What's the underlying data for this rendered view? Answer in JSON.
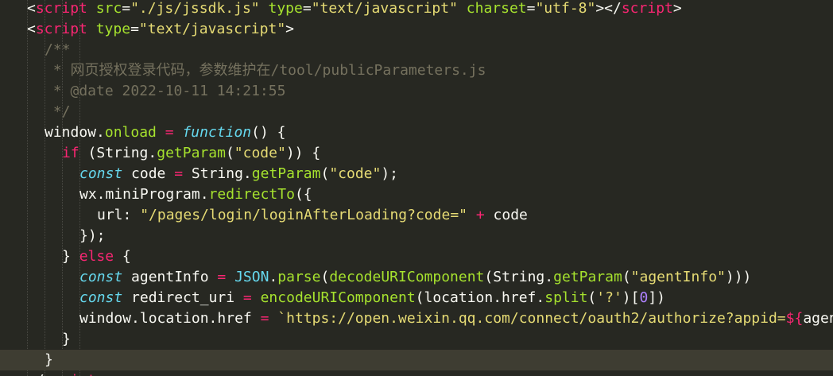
{
  "lines": [
    {
      "tokens": [
        {
          "t": "<",
          "c": "t-punct"
        },
        {
          "t": "script",
          "c": "t-tag"
        },
        {
          "t": " ",
          "c": "t-plain"
        },
        {
          "t": "src",
          "c": "t-attr"
        },
        {
          "t": "=",
          "c": "t-punct"
        },
        {
          "t": "\"./js/jssdk.js\"",
          "c": "t-str"
        },
        {
          "t": " ",
          "c": "t-plain"
        },
        {
          "t": "type",
          "c": "t-attr"
        },
        {
          "t": "=",
          "c": "t-punct"
        },
        {
          "t": "\"text/javascript\"",
          "c": "t-str"
        },
        {
          "t": " ",
          "c": "t-plain"
        },
        {
          "t": "charset",
          "c": "t-attr"
        },
        {
          "t": "=",
          "c": "t-punct"
        },
        {
          "t": "\"utf-8\"",
          "c": "t-str"
        },
        {
          "t": "></",
          "c": "t-punct"
        },
        {
          "t": "script",
          "c": "t-tag"
        },
        {
          "t": ">",
          "c": "t-punct"
        }
      ]
    },
    {
      "tokens": [
        {
          "t": "<",
          "c": "t-punct"
        },
        {
          "t": "script",
          "c": "t-tag"
        },
        {
          "t": " ",
          "c": "t-plain"
        },
        {
          "t": "type",
          "c": "t-attr"
        },
        {
          "t": "=",
          "c": "t-punct"
        },
        {
          "t": "\"text/javascript\"",
          "c": "t-str"
        },
        {
          "t": ">",
          "c": "t-punct"
        }
      ]
    },
    {
      "tokens": [
        {
          "t": "/**",
          "c": "t-comment"
        }
      ]
    },
    {
      "tokens": [
        {
          "t": " * 网页授权登录代码，参数维护在/tool/publicParameters.js",
          "c": "t-comment"
        }
      ]
    },
    {
      "tokens": [
        {
          "t": " * @date 2022-10-11 14:21:55",
          "c": "t-comment"
        }
      ]
    },
    {
      "tokens": [
        {
          "t": " */",
          "c": "t-comment"
        }
      ]
    },
    {
      "tokens": [
        {
          "t": "window",
          "c": "t-plain"
        },
        {
          "t": ".",
          "c": "t-plain"
        },
        {
          "t": "onload",
          "c": "t-func"
        },
        {
          "t": " ",
          "c": "t-plain"
        },
        {
          "t": "=",
          "c": "t-op"
        },
        {
          "t": " ",
          "c": "t-plain"
        },
        {
          "t": "function",
          "c": "t-kw"
        },
        {
          "t": "() ",
          "c": "t-plain"
        },
        {
          "t": "{",
          "c": "t-plain"
        }
      ]
    },
    {
      "tokens": [
        {
          "t": "if",
          "c": "t-ctrl"
        },
        {
          "t": " (String.",
          "c": "t-plain"
        },
        {
          "t": "getParam",
          "c": "t-func"
        },
        {
          "t": "(",
          "c": "t-plain"
        },
        {
          "t": "\"code\"",
          "c": "t-str"
        },
        {
          "t": ")) {",
          "c": "t-plain"
        }
      ]
    },
    {
      "tokens": [
        {
          "t": "const",
          "c": "t-kw"
        },
        {
          "t": " code ",
          "c": "t-plain"
        },
        {
          "t": "=",
          "c": "t-op"
        },
        {
          "t": " String.",
          "c": "t-plain"
        },
        {
          "t": "getParam",
          "c": "t-func"
        },
        {
          "t": "(",
          "c": "t-plain"
        },
        {
          "t": "\"code\"",
          "c": "t-str"
        },
        {
          "t": ");",
          "c": "t-plain"
        }
      ]
    },
    {
      "tokens": [
        {
          "t": "wx.miniProgram.",
          "c": "t-plain"
        },
        {
          "t": "redirectTo",
          "c": "t-func"
        },
        {
          "t": "({",
          "c": "t-plain"
        }
      ]
    },
    {
      "tokens": [
        {
          "t": "url: ",
          "c": "t-plain"
        },
        {
          "t": "\"/pages/login/loginAfterLoading?code=\"",
          "c": "t-str"
        },
        {
          "t": " ",
          "c": "t-plain"
        },
        {
          "t": "+",
          "c": "t-op"
        },
        {
          "t": " code",
          "c": "t-plain"
        }
      ]
    },
    {
      "tokens": [
        {
          "t": "});",
          "c": "t-plain"
        }
      ]
    },
    {
      "tokens": [
        {
          "t": "} ",
          "c": "t-plain"
        },
        {
          "t": "else",
          "c": "t-ctrl"
        },
        {
          "t": " {",
          "c": "t-plain"
        }
      ]
    },
    {
      "tokens": [
        {
          "t": "const",
          "c": "t-kw"
        },
        {
          "t": " agentInfo ",
          "c": "t-plain"
        },
        {
          "t": "=",
          "c": "t-op"
        },
        {
          "t": " ",
          "c": "t-plain"
        },
        {
          "t": "JSON",
          "c": "t-builtin"
        },
        {
          "t": ".",
          "c": "t-plain"
        },
        {
          "t": "parse",
          "c": "t-func"
        },
        {
          "t": "(",
          "c": "t-plain"
        },
        {
          "t": "decodeURIComponent",
          "c": "t-func"
        },
        {
          "t": "(String.",
          "c": "t-plain"
        },
        {
          "t": "getParam",
          "c": "t-func"
        },
        {
          "t": "(",
          "c": "t-plain"
        },
        {
          "t": "\"agentInfo\"",
          "c": "t-str"
        },
        {
          "t": ")))",
          "c": "t-plain"
        }
      ]
    },
    {
      "tokens": [
        {
          "t": "const",
          "c": "t-kw"
        },
        {
          "t": " redirect_uri ",
          "c": "t-plain"
        },
        {
          "t": "=",
          "c": "t-op"
        },
        {
          "t": " ",
          "c": "t-plain"
        },
        {
          "t": "encodeURIComponent",
          "c": "t-func"
        },
        {
          "t": "(location.href.",
          "c": "t-plain"
        },
        {
          "t": "split",
          "c": "t-func"
        },
        {
          "t": "(",
          "c": "t-plain"
        },
        {
          "t": "'?'",
          "c": "t-str"
        },
        {
          "t": ")[",
          "c": "t-plain"
        },
        {
          "t": "0",
          "c": "t-num"
        },
        {
          "t": "])",
          "c": "t-plain"
        }
      ]
    },
    {
      "tokens": [
        {
          "t": "window.location.href ",
          "c": "t-plain"
        },
        {
          "t": "=",
          "c": "t-op"
        },
        {
          "t": " ",
          "c": "t-plain"
        },
        {
          "t": "`https://open.weixin.qq.com/connect/oauth2/authorize?appid=",
          "c": "t-str"
        },
        {
          "t": "${",
          "c": "t-op"
        },
        {
          "t": "agentInfo.appid",
          "c": "t-plain"
        }
      ]
    },
    {
      "tokens": [
        {
          "t": "}",
          "c": "t-plain"
        }
      ]
    },
    {
      "tokens": [
        {
          "t": "}",
          "c": "t-plain"
        }
      ]
    },
    {
      "tokens": [
        {
          "t": "</",
          "c": "t-punct"
        },
        {
          "t": "script",
          "c": "t-tag"
        },
        {
          "t": ">",
          "c": "t-punct"
        }
      ]
    }
  ]
}
